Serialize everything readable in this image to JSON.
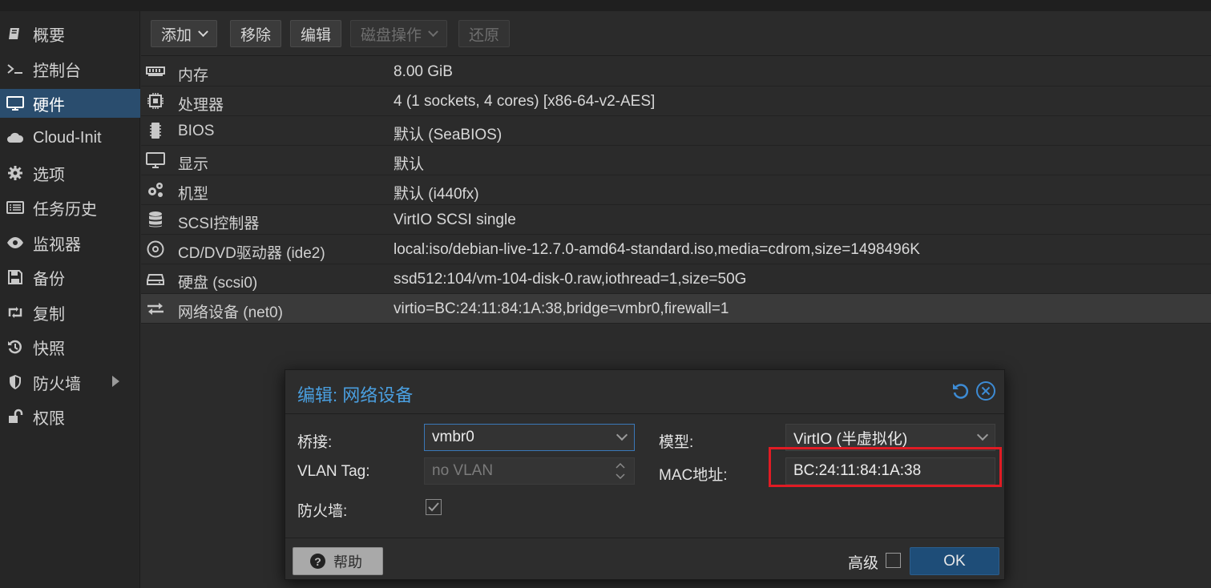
{
  "sidebar": {
    "items": [
      {
        "label": "概要",
        "icon": "book-icon"
      },
      {
        "label": "控制台",
        "icon": "terminal-icon"
      },
      {
        "label": "硬件",
        "icon": "monitor-icon",
        "active": true
      },
      {
        "label": "Cloud-Init",
        "icon": "cloud-icon"
      },
      {
        "label": "选项",
        "icon": "gear-icon"
      },
      {
        "label": "任务历史",
        "icon": "list-icon"
      },
      {
        "label": "监视器",
        "icon": "eye-icon"
      },
      {
        "label": "备份",
        "icon": "floppy-icon"
      },
      {
        "label": "复制",
        "icon": "retweet-icon"
      },
      {
        "label": "快照",
        "icon": "history-icon"
      },
      {
        "label": "防火墙",
        "icon": "shield-icon",
        "has_submenu": true
      },
      {
        "label": "权限",
        "icon": "unlock-icon"
      }
    ]
  },
  "toolbar": {
    "add": "添加",
    "remove": "移除",
    "edit": "编辑",
    "disk_action": "磁盘操作",
    "revert": "还原"
  },
  "hardware": [
    {
      "name": "内存",
      "value": "8.00 GiB",
      "icon": "memory-icon"
    },
    {
      "name": "处理器",
      "value": "4 (1 sockets, 4 cores) [x86-64-v2-AES]",
      "icon": "cpu-icon"
    },
    {
      "name": "BIOS",
      "value": "默认 (SeaBIOS)",
      "icon": "microchip-icon"
    },
    {
      "name": "显示",
      "value": "默认",
      "icon": "desktop-icon"
    },
    {
      "name": "机型",
      "value": "默认 (i440fx)",
      "icon": "cogs-icon"
    },
    {
      "name": "SCSI控制器",
      "value": "VirtIO SCSI single",
      "icon": "database-icon"
    },
    {
      "name": "CD/DVD驱动器 (ide2)",
      "value": "local:iso/debian-live-12.7.0-amd64-standard.iso,media=cdrom,size=1498496K",
      "icon": "cdrom-icon"
    },
    {
      "name": "硬盘 (scsi0)",
      "value": "ssd512:104/vm-104-disk-0.raw,iothread=1,size=50G",
      "icon": "hdd-icon"
    },
    {
      "name": "网络设备 (net0)",
      "value": "virtio=BC:24:11:84:1A:38,bridge=vmbr0,firewall=1",
      "icon": "exchange-icon",
      "selected": true
    }
  ],
  "dialog": {
    "title": "编辑: 网络设备",
    "bridge_label": "桥接:",
    "bridge_value": "vmbr0",
    "vlan_label": "VLAN Tag:",
    "vlan_placeholder": "no VLAN",
    "firewall_label": "防火墙:",
    "firewall_checked": true,
    "model_label": "模型:",
    "model_value": "VirtIO (半虚拟化)",
    "mac_label": "MAC地址:",
    "mac_value": "BC:24:11:84:1A:38",
    "help": "帮助",
    "advanced": "高级",
    "advanced_checked": false,
    "ok": "OK"
  },
  "colors": {
    "accent": "#4a9fe0",
    "active_nav": "#2a4d6e",
    "highlight": "#e01b24",
    "ok_button": "#1e4d78"
  }
}
